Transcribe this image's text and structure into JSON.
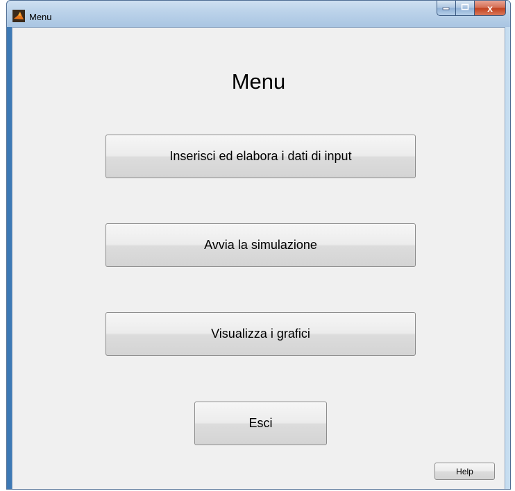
{
  "window": {
    "title": "Menu",
    "icon": "matlab-icon",
    "controls": {
      "minimize": "minimize-icon",
      "maximize": "maximize-icon",
      "close_symbol": "x"
    }
  },
  "main": {
    "heading": "Menu",
    "buttons": {
      "input": "Inserisci ed elabora i dati di input",
      "simulation": "Avvia la simulazione",
      "charts": "Visualizza i grafici",
      "exit": "Esci",
      "help": "Help"
    }
  },
  "colors": {
    "client_background": "#f0f0f0",
    "titlebar": "#bcd3ea",
    "close_button": "#c1401e"
  }
}
